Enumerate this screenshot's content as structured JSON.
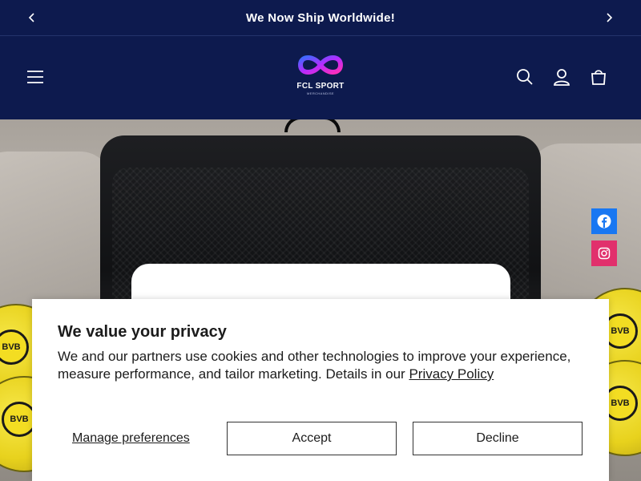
{
  "announcement": {
    "text": "We Now Ship Worldwide!"
  },
  "logo": {
    "brand": "FCL SPORT",
    "tagline": "MERCHANDISE"
  },
  "social": [
    {
      "name": "facebook",
      "color": "#1877f2"
    },
    {
      "name": "instagram",
      "color": "#e1306c"
    }
  ],
  "ball_emblem": "BVB",
  "cookie_banner": {
    "title": "We value your privacy",
    "body": "We and our partners use cookies and other technologies to improve your experience, measure performance, and tailor marketing. Details in our ",
    "policy_link": "Privacy Policy",
    "manage_label": "Manage preferences",
    "accept_label": "Accept",
    "decline_label": "Decline"
  },
  "colors": {
    "header_bg": "#0d1a4e",
    "text": "#1c1c1c"
  }
}
